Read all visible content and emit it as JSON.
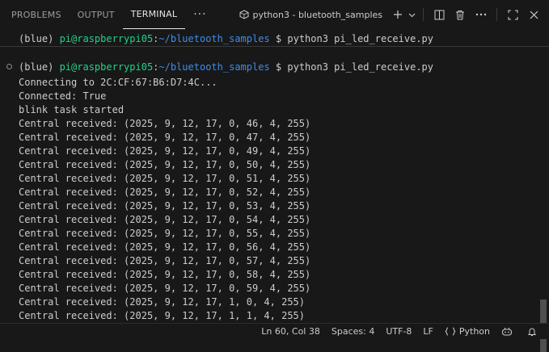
{
  "panel_tabs": [
    "PROBLEMS",
    "OUTPUT",
    "TERMINAL"
  ],
  "more_label": "···",
  "terminal_name": "python3 - bluetooth_samples",
  "prompt": {
    "env": "(blue) ",
    "user": "pi@raspberrypi05",
    "colon": ":",
    "path": "~/bluetooth_samples",
    "suffix": " $ ",
    "command": "python3 pi_led_receive.py"
  },
  "output_lines": [
    "Connecting to 2C:CF:67:B6:D7:4C...",
    "Connected: True",
    "blink task started",
    "Central received: (2025, 9, 12, 17, 0, 46, 4, 255)",
    "Central received: (2025, 9, 12, 17, 0, 47, 4, 255)",
    "Central received: (2025, 9, 12, 17, 0, 49, 4, 255)",
    "Central received: (2025, 9, 12, 17, 0, 50, 4, 255)",
    "Central received: (2025, 9, 12, 17, 0, 51, 4, 255)",
    "Central received: (2025, 9, 12, 17, 0, 52, 4, 255)",
    "Central received: (2025, 9, 12, 17, 0, 53, 4, 255)",
    "Central received: (2025, 9, 12, 17, 0, 54, 4, 255)",
    "Central received: (2025, 9, 12, 17, 0, 55, 4, 255)",
    "Central received: (2025, 9, 12, 17, 0, 56, 4, 255)",
    "Central received: (2025, 9, 12, 17, 0, 57, 4, 255)",
    "Central received: (2025, 9, 12, 17, 0, 58, 4, 255)",
    "Central received: (2025, 9, 12, 17, 0, 59, 4, 255)",
    "Central received: (2025, 9, 12, 17, 1, 0, 4, 255)",
    "Central received: (2025, 9, 12, 17, 1, 1, 4, 255)"
  ],
  "status": {
    "position": "Ln 60, Col 38",
    "spaces": "Spaces: 4",
    "encoding": "UTF-8",
    "eol": "LF",
    "language": "Python"
  },
  "colors": {
    "background": "#181818",
    "prompt_user": "#23d18b",
    "prompt_path": "#3b8eea",
    "text": "#cccccc"
  }
}
